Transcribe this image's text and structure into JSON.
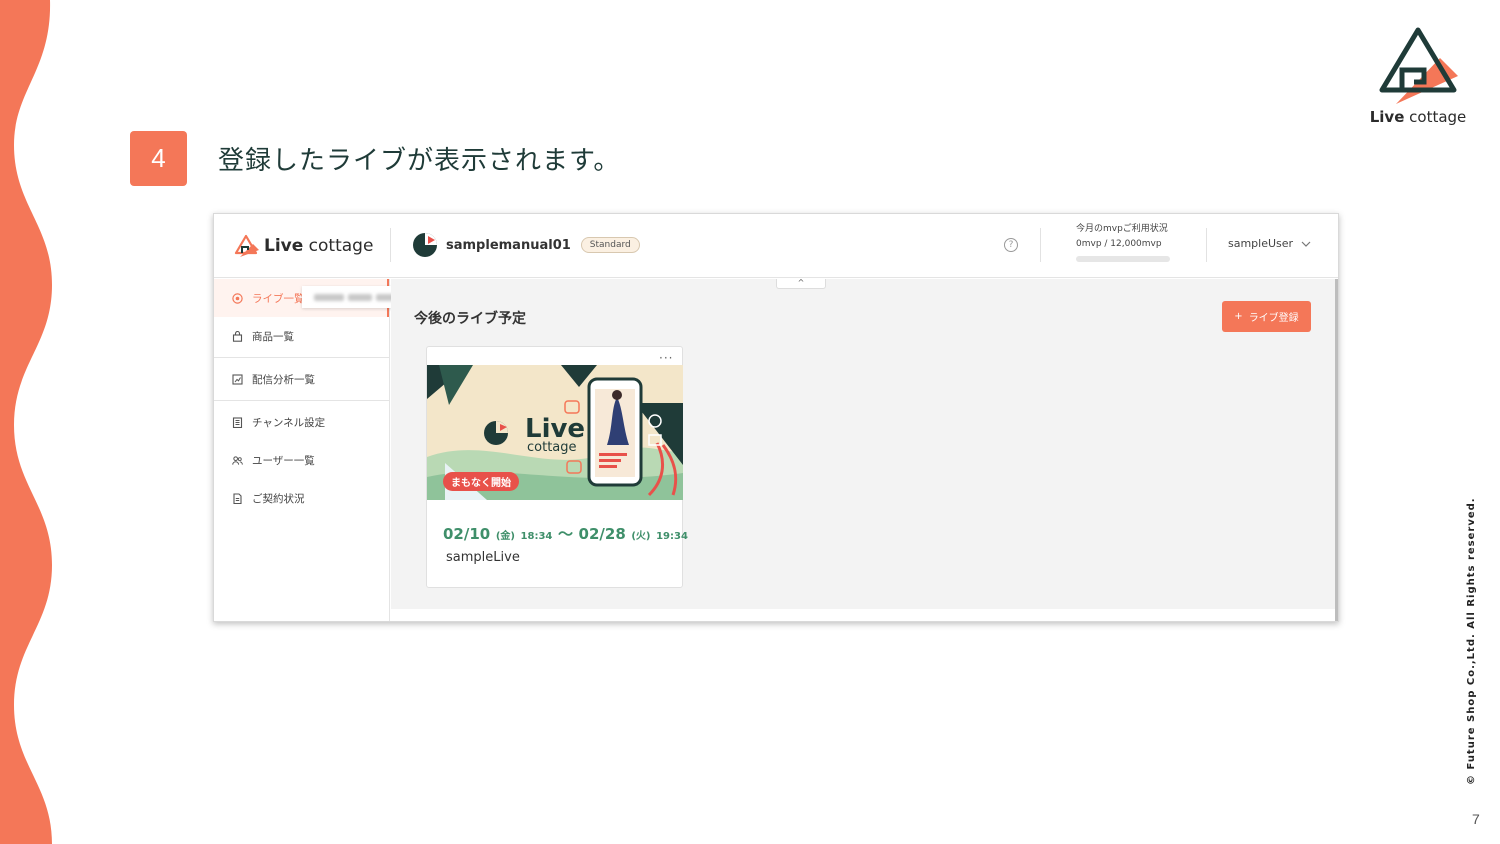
{
  "slide": {
    "step_number": "4",
    "instruction": "登録したライブが表示されます。",
    "copyright": "© Future Shop Co.,Ltd. All Rights reserved.",
    "page_number": "7",
    "brand": {
      "logo_bold": "Live",
      "logo_light": " cottage"
    }
  },
  "app": {
    "logo_bold": "Live",
    "logo_light": " cottage",
    "channel_name": "samplemanual01",
    "plan": "Standard",
    "usage_label": "今月のmvpご利用状況",
    "usage_value": "0mvp / 12,000mvp",
    "usage_fraction": 0,
    "user_name": "sampleUser",
    "help_icon": "question-circle-icon"
  },
  "sidebar": {
    "items": [
      {
        "label": "ライブ一覧",
        "icon": "live-icon",
        "active": true
      },
      {
        "label": "商品一覧",
        "icon": "bag-icon"
      },
      {
        "label": "配信分析一覧",
        "icon": "chart-icon"
      },
      {
        "label": "チャンネル設定",
        "icon": "building-icon"
      },
      {
        "label": "ユーザー一覧",
        "icon": "users-icon"
      },
      {
        "label": "ご契約状況",
        "icon": "document-icon"
      }
    ]
  },
  "main": {
    "section_title": "今後のライブ予定",
    "register_button": "ライブ登録",
    "card": {
      "badge": "まもなく開始",
      "start_date": "02/10",
      "start_day": "(金)",
      "start_time": "18:34",
      "separator": "〜",
      "end_date": "02/28",
      "end_day": "(火)",
      "end_time": "19:34",
      "name": "sampleLive",
      "thumb_title": "Live",
      "thumb_subtitle": "cottage"
    }
  },
  "colors": {
    "accent": "#f47758",
    "schedule": "#3f8f6a",
    "dark": "#1f3b38",
    "badge": "#e8514a"
  }
}
